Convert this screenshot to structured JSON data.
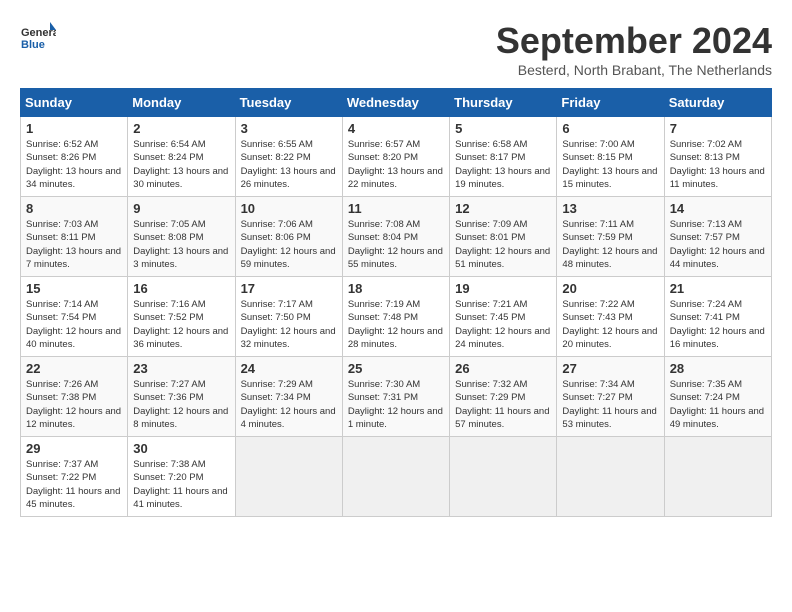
{
  "logo": {
    "text_general": "General",
    "text_blue": "Blue"
  },
  "title": "September 2024",
  "location": "Besterd, North Brabant, The Netherlands",
  "days_of_week": [
    "Sunday",
    "Monday",
    "Tuesday",
    "Wednesday",
    "Thursday",
    "Friday",
    "Saturday"
  ],
  "weeks": [
    [
      {
        "day": "1",
        "sunrise": "6:52 AM",
        "sunset": "8:26 PM",
        "daylight": "13 hours and 34 minutes."
      },
      {
        "day": "2",
        "sunrise": "6:54 AM",
        "sunset": "8:24 PM",
        "daylight": "13 hours and 30 minutes."
      },
      {
        "day": "3",
        "sunrise": "6:55 AM",
        "sunset": "8:22 PM",
        "daylight": "13 hours and 26 minutes."
      },
      {
        "day": "4",
        "sunrise": "6:57 AM",
        "sunset": "8:20 PM",
        "daylight": "13 hours and 22 minutes."
      },
      {
        "day": "5",
        "sunrise": "6:58 AM",
        "sunset": "8:17 PM",
        "daylight": "13 hours and 19 minutes."
      },
      {
        "day": "6",
        "sunrise": "7:00 AM",
        "sunset": "8:15 PM",
        "daylight": "13 hours and 15 minutes."
      },
      {
        "day": "7",
        "sunrise": "7:02 AM",
        "sunset": "8:13 PM",
        "daylight": "13 hours and 11 minutes."
      }
    ],
    [
      {
        "day": "8",
        "sunrise": "7:03 AM",
        "sunset": "8:11 PM",
        "daylight": "13 hours and 7 minutes."
      },
      {
        "day": "9",
        "sunrise": "7:05 AM",
        "sunset": "8:08 PM",
        "daylight": "13 hours and 3 minutes."
      },
      {
        "day": "10",
        "sunrise": "7:06 AM",
        "sunset": "8:06 PM",
        "daylight": "12 hours and 59 minutes."
      },
      {
        "day": "11",
        "sunrise": "7:08 AM",
        "sunset": "8:04 PM",
        "daylight": "12 hours and 55 minutes."
      },
      {
        "day": "12",
        "sunrise": "7:09 AM",
        "sunset": "8:01 PM",
        "daylight": "12 hours and 51 minutes."
      },
      {
        "day": "13",
        "sunrise": "7:11 AM",
        "sunset": "7:59 PM",
        "daylight": "12 hours and 48 minutes."
      },
      {
        "day": "14",
        "sunrise": "7:13 AM",
        "sunset": "7:57 PM",
        "daylight": "12 hours and 44 minutes."
      }
    ],
    [
      {
        "day": "15",
        "sunrise": "7:14 AM",
        "sunset": "7:54 PM",
        "daylight": "12 hours and 40 minutes."
      },
      {
        "day": "16",
        "sunrise": "7:16 AM",
        "sunset": "7:52 PM",
        "daylight": "12 hours and 36 minutes."
      },
      {
        "day": "17",
        "sunrise": "7:17 AM",
        "sunset": "7:50 PM",
        "daylight": "12 hours and 32 minutes."
      },
      {
        "day": "18",
        "sunrise": "7:19 AM",
        "sunset": "7:48 PM",
        "daylight": "12 hours and 28 minutes."
      },
      {
        "day": "19",
        "sunrise": "7:21 AM",
        "sunset": "7:45 PM",
        "daylight": "12 hours and 24 minutes."
      },
      {
        "day": "20",
        "sunrise": "7:22 AM",
        "sunset": "7:43 PM",
        "daylight": "12 hours and 20 minutes."
      },
      {
        "day": "21",
        "sunrise": "7:24 AM",
        "sunset": "7:41 PM",
        "daylight": "12 hours and 16 minutes."
      }
    ],
    [
      {
        "day": "22",
        "sunrise": "7:26 AM",
        "sunset": "7:38 PM",
        "daylight": "12 hours and 12 minutes."
      },
      {
        "day": "23",
        "sunrise": "7:27 AM",
        "sunset": "7:36 PM",
        "daylight": "12 hours and 8 minutes."
      },
      {
        "day": "24",
        "sunrise": "7:29 AM",
        "sunset": "7:34 PM",
        "daylight": "12 hours and 4 minutes."
      },
      {
        "day": "25",
        "sunrise": "7:30 AM",
        "sunset": "7:31 PM",
        "daylight": "12 hours and 1 minute."
      },
      {
        "day": "26",
        "sunrise": "7:32 AM",
        "sunset": "7:29 PM",
        "daylight": "11 hours and 57 minutes."
      },
      {
        "day": "27",
        "sunrise": "7:34 AM",
        "sunset": "7:27 PM",
        "daylight": "11 hours and 53 minutes."
      },
      {
        "day": "28",
        "sunrise": "7:35 AM",
        "sunset": "7:24 PM",
        "daylight": "11 hours and 49 minutes."
      }
    ],
    [
      {
        "day": "29",
        "sunrise": "7:37 AM",
        "sunset": "7:22 PM",
        "daylight": "11 hours and 45 minutes."
      },
      {
        "day": "30",
        "sunrise": "7:38 AM",
        "sunset": "7:20 PM",
        "daylight": "11 hours and 41 minutes."
      },
      null,
      null,
      null,
      null,
      null
    ]
  ]
}
